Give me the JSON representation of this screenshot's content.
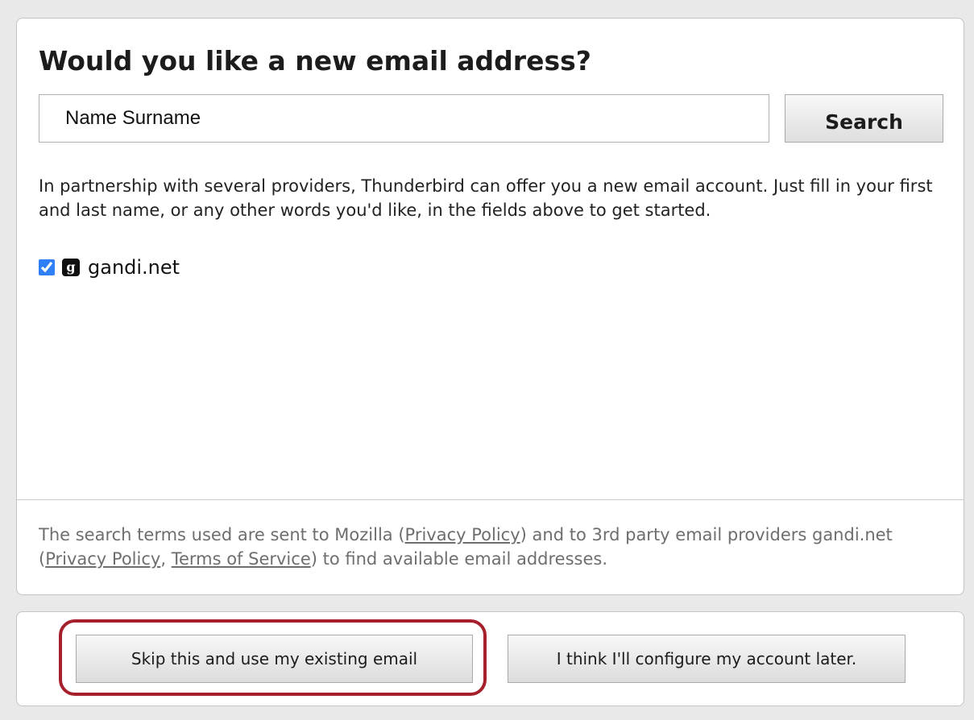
{
  "main": {
    "heading": "Would you like a new email address?",
    "search": {
      "value": "Name Surname",
      "placeholder": "",
      "button_label": "Search"
    },
    "description": "In partnership with several providers, Thunderbird can offer you a new email account. Just fill in your first and last name, or any other words you'd like, in the fields above to get started.",
    "providers": [
      {
        "name": "gandi.net",
        "checked": true,
        "logo_icon": "gandi-logo-icon",
        "logo_glyph": "g"
      }
    ]
  },
  "footer_note": {
    "part1": "The search terms used are sent to Mozilla (",
    "mozilla_privacy_link": "Privacy Policy",
    "part2": ") and to 3rd party email providers gandi.net (",
    "provider_privacy_link": "Privacy Policy",
    "separator": ", ",
    "provider_terms_link": "Terms of Service",
    "part3": ") to find available email addresses."
  },
  "buttons": {
    "skip_label": "Skip this and use my existing email",
    "later_label": "I think I'll configure my account later."
  },
  "colors": {
    "highlight": "#a6202b",
    "checkbox_accent": "#2f7ff5"
  }
}
